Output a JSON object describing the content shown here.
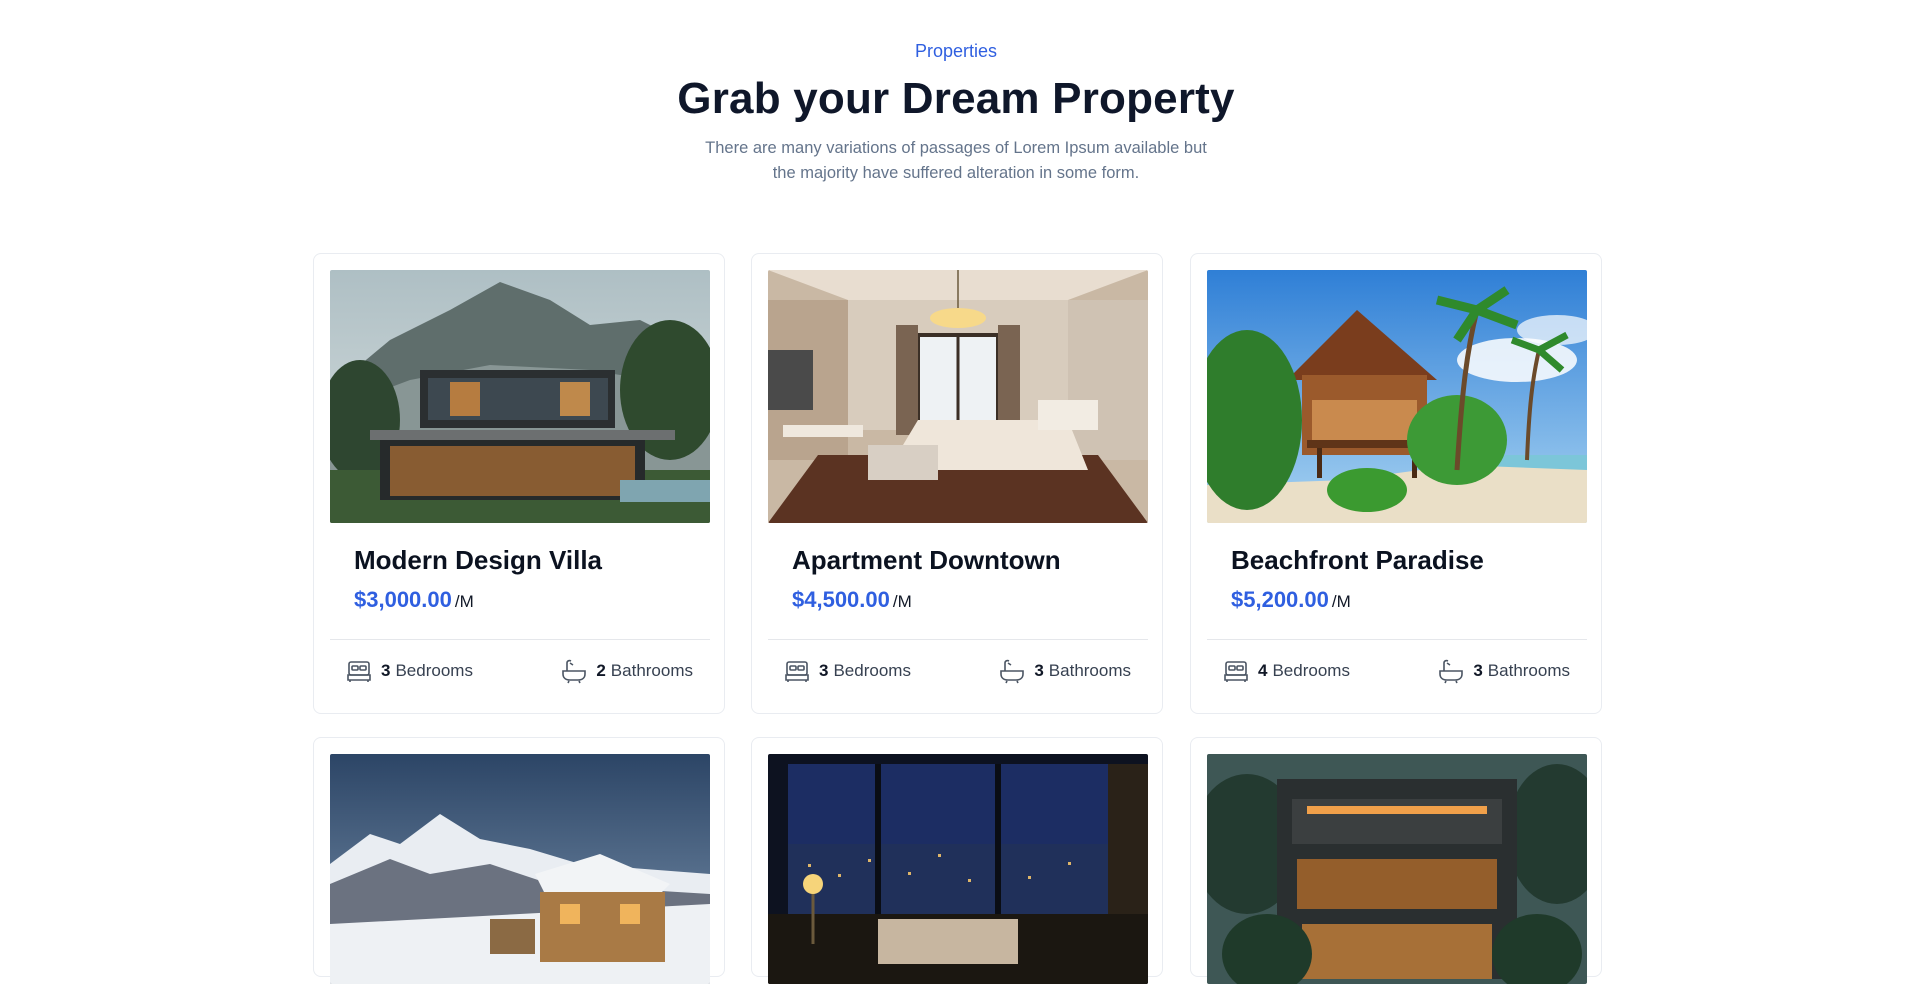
{
  "header": {
    "eyebrow": "Properties",
    "title": "Grab your Dream Property",
    "subtitle": "There are many variations of passages of Lorem Ipsum available but the majority have suffered alteration in some form."
  },
  "colors": {
    "accent": "#2f5fe0",
    "heading": "#0f172a",
    "muted": "#64748b",
    "border": "#e9ecf1"
  },
  "properties": [
    {
      "name": "Modern Design Villa",
      "price": "$3,000.00",
      "unit": "/M",
      "bedrooms": "3",
      "bedrooms_label": "Bedrooms",
      "bathrooms": "2",
      "bathrooms_label": "Bathrooms",
      "image": "villa-in-misty-mountains"
    },
    {
      "name": "Apartment Downtown",
      "price": "$4,500.00",
      "unit": "/M",
      "bedrooms": "3",
      "bedrooms_label": "Bedrooms",
      "bathrooms": "3",
      "bathrooms_label": "Bathrooms",
      "image": "luxury-bedroom-interior"
    },
    {
      "name": "Beachfront Paradise",
      "price": "$5,200.00",
      "unit": "/M",
      "bedrooms": "4",
      "bedrooms_label": "Bedrooms",
      "bathrooms": "3",
      "bathrooms_label": "Bathrooms",
      "image": "wooden-beach-house-with-palms"
    },
    {
      "image": "snowy-mountain-chalet"
    },
    {
      "image": "city-view-living-room-at-night"
    },
    {
      "image": "modern-house-lit-at-night"
    }
  ],
  "icons": {
    "bed": "bed-icon",
    "bath": "bathtub-icon"
  }
}
